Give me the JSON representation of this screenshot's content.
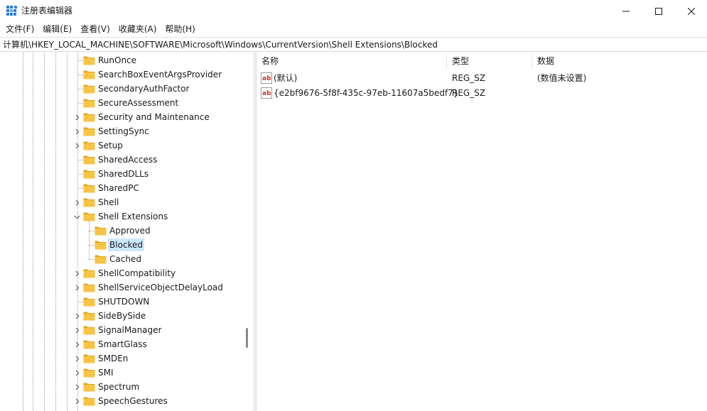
{
  "window": {
    "title": "注册表编辑器"
  },
  "menu": [
    "文件(F)",
    "编辑(E)",
    "查看(V)",
    "收藏夹(A)",
    "帮助(H)"
  ],
  "address": "计算机\\HKEY_LOCAL_MACHINE\\SOFTWARE\\Microsoft\\Windows\\CurrentVersion\\Shell Extensions\\Blocked",
  "tree": {
    "items": [
      {
        "label": "RunOnce",
        "expander": "none"
      },
      {
        "label": "SearchBoxEventArgsProvider",
        "expander": "none"
      },
      {
        "label": "SecondaryAuthFactor",
        "expander": "none"
      },
      {
        "label": "SecureAssessment",
        "expander": "none"
      },
      {
        "label": "Security and Maintenance",
        "expander": "collapsed"
      },
      {
        "label": "SettingSync",
        "expander": "collapsed"
      },
      {
        "label": "Setup",
        "expander": "collapsed"
      },
      {
        "label": "SharedAccess",
        "expander": "none"
      },
      {
        "label": "SharedDLLs",
        "expander": "none"
      },
      {
        "label": "SharedPC",
        "expander": "none"
      },
      {
        "label": "Shell",
        "expander": "collapsed"
      },
      {
        "label": "Shell Extensions",
        "expander": "expanded"
      },
      {
        "label": "Approved",
        "expander": "none",
        "child": true
      },
      {
        "label": "Blocked",
        "expander": "none",
        "child": true,
        "selected": true
      },
      {
        "label": "Cached",
        "expander": "none",
        "child": true
      },
      {
        "label": "ShellCompatibility",
        "expander": "collapsed"
      },
      {
        "label": "ShellServiceObjectDelayLoad",
        "expander": "collapsed"
      },
      {
        "label": "SHUTDOWN",
        "expander": "none"
      },
      {
        "label": "SideBySide",
        "expander": "collapsed"
      },
      {
        "label": "SignalManager",
        "expander": "collapsed"
      },
      {
        "label": "SmartGlass",
        "expander": "collapsed"
      },
      {
        "label": "SMDEn",
        "expander": "collapsed"
      },
      {
        "label": "SMI",
        "expander": "collapsed"
      },
      {
        "label": "Spectrum",
        "expander": "collapsed"
      },
      {
        "label": "SpeechGestures",
        "expander": "collapsed"
      }
    ]
  },
  "list": {
    "columns": [
      "名称",
      "类型",
      "数据"
    ],
    "rows": [
      {
        "name": "(默认)",
        "type": "REG_SZ",
        "data": "(数值未设置)"
      },
      {
        "name": "{e2bf9676-5f8f-435c-97eb-11607a5bedf7}",
        "type": "REG_SZ",
        "data": ""
      }
    ]
  },
  "colors": {
    "selection": "#cce8ff",
    "folder": "#f8c445",
    "folder_dark": "#e0a520",
    "app_icon": "#2b7bd9"
  }
}
